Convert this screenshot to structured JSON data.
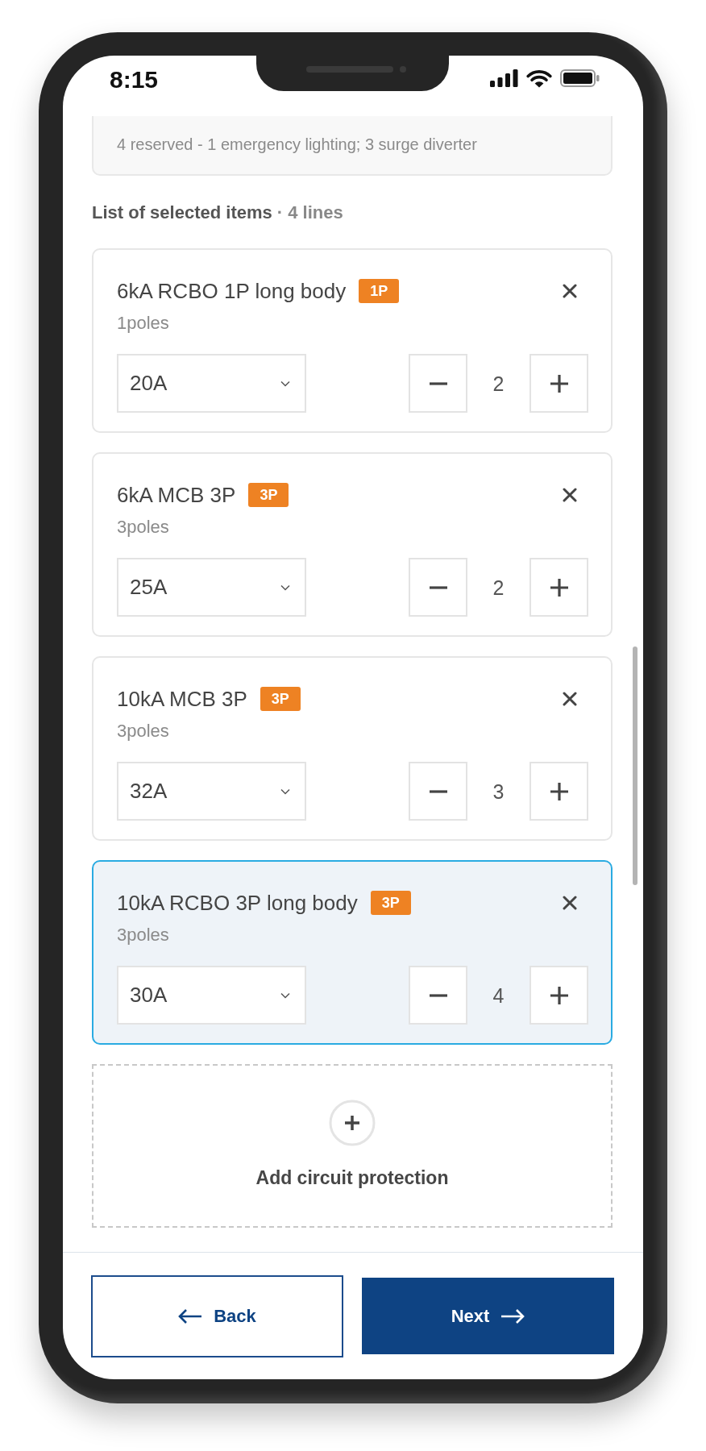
{
  "status_bar": {
    "time": "8:15"
  },
  "notes": {
    "text": "4 reserved - 1 emergency lighting; 3 surge diverter"
  },
  "list_heading": {
    "title": "List of selected items",
    "count": "· 4 lines"
  },
  "items": [
    {
      "name": "6kA RCBO 1P long body",
      "badge": "1P",
      "poles": "1poles",
      "rating": "20A",
      "quantity": "2",
      "selected": false
    },
    {
      "name": "6kA MCB 3P",
      "badge": "3P",
      "poles": "3poles",
      "rating": "25A",
      "quantity": "2",
      "selected": false
    },
    {
      "name": "10kA MCB 3P",
      "badge": "3P",
      "poles": "3poles",
      "rating": "32A",
      "quantity": "3",
      "selected": false
    },
    {
      "name": "10kA RCBO 3P long body",
      "badge": "3P",
      "poles": "3poles",
      "rating": "30A",
      "quantity": "4",
      "selected": true
    }
  ],
  "add_button": {
    "label": "Add circuit protection"
  },
  "footer": {
    "back": "Back",
    "next": "Next"
  }
}
